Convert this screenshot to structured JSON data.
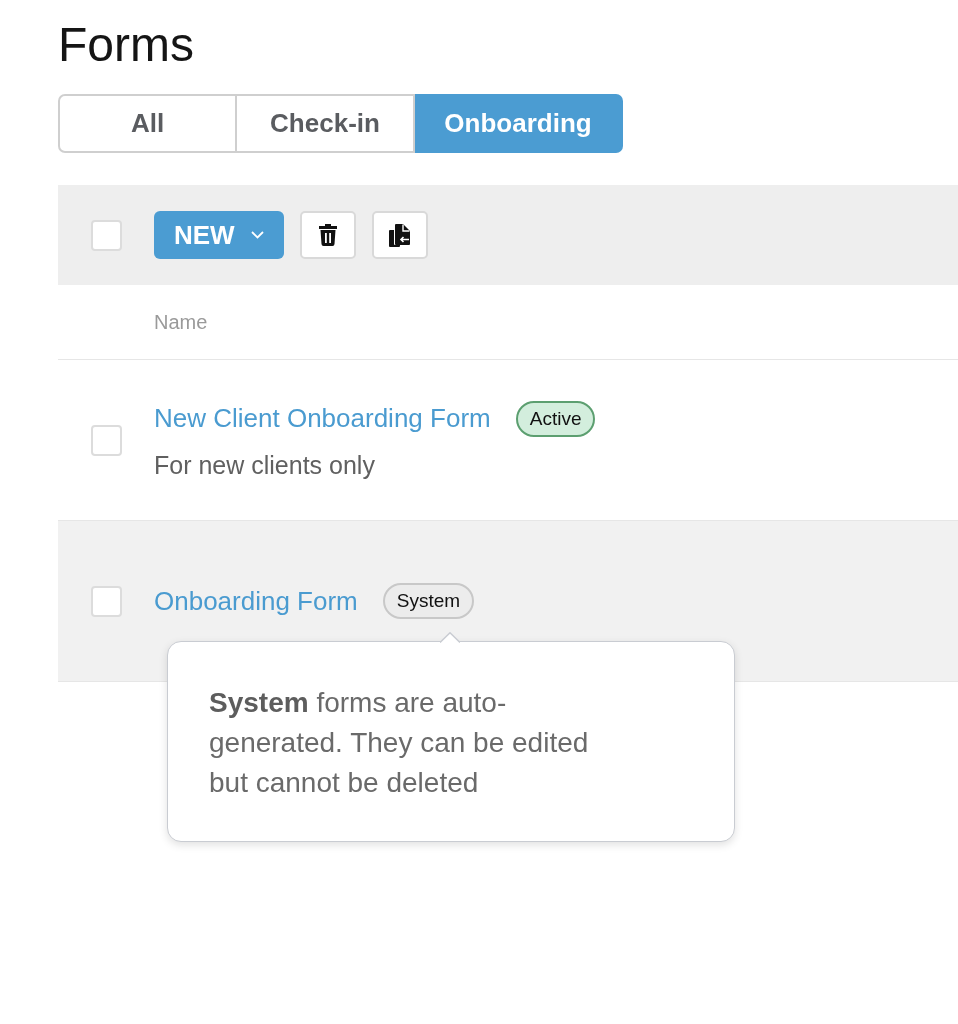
{
  "page": {
    "title": "Forms"
  },
  "tabs": [
    {
      "label": "All",
      "selected": false
    },
    {
      "label": "Check-in",
      "selected": false
    },
    {
      "label": "Onboarding",
      "selected": true
    }
  ],
  "toolbar": {
    "select_all": {
      "checked": false
    },
    "new_button": {
      "label": "NEW"
    }
  },
  "table": {
    "columns": [
      "Name"
    ],
    "rows": [
      {
        "checked": false,
        "highlighted": false,
        "title": "New Client Onboarding Form",
        "badge": {
          "label": "Active",
          "kind": "active"
        },
        "subtitle": "For new clients only"
      },
      {
        "checked": false,
        "highlighted": true,
        "title": "Onboarding Form",
        "badge": {
          "label": "System",
          "kind": "system"
        },
        "tooltip": {
          "text": "**System** forms are auto-generated. They can be edited but cannot be deleted"
        }
      }
    ]
  }
}
